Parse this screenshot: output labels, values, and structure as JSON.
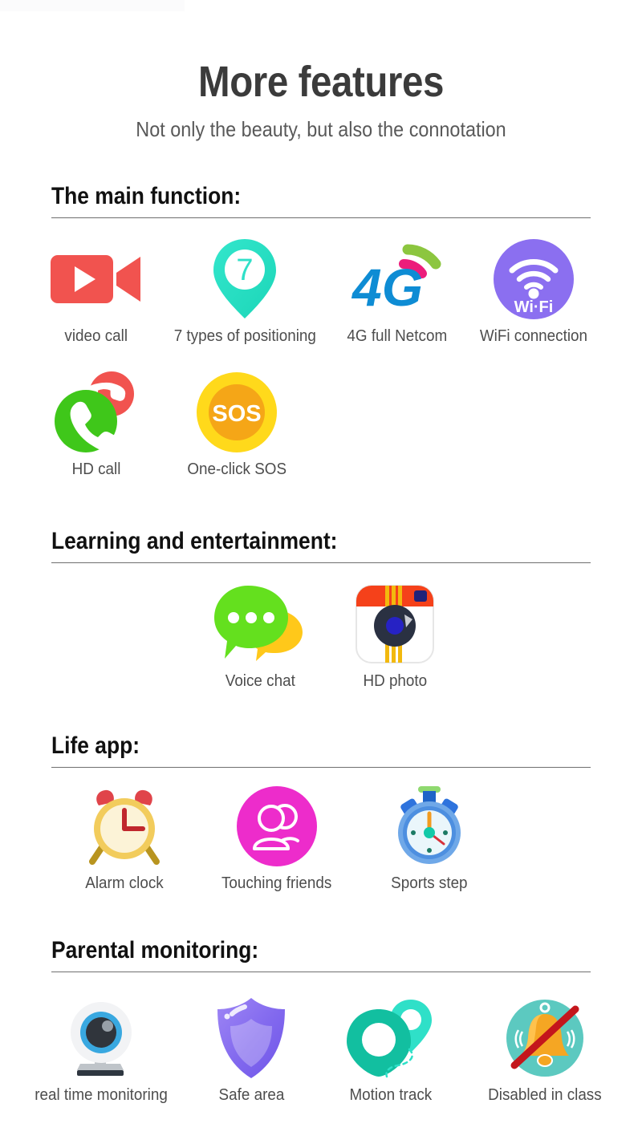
{
  "header": {
    "title": "More features",
    "subtitle": "Not only the beauty, but also the connotation"
  },
  "sections": [
    {
      "id": "main",
      "heading": "The main function:",
      "rows": [
        [
          {
            "icon": "video-camera-icon",
            "label": "video call"
          },
          {
            "icon": "location-pin-7-icon",
            "label": "7 types of positioning"
          },
          {
            "icon": "4g-signal-icon",
            "label": "4G full Netcom"
          },
          {
            "icon": "wifi-circle-icon",
            "label": "WiFi connection"
          }
        ],
        [
          {
            "icon": "phone-call-icon",
            "label": "HD call"
          },
          {
            "icon": "sos-button-icon",
            "label": "One-click SOS"
          }
        ]
      ]
    },
    {
      "id": "learn",
      "heading": "Learning and entertainment:",
      "rows": [
        [
          {
            "icon": "speech-bubbles-icon",
            "label": "Voice chat"
          },
          {
            "icon": "camera-app-icon",
            "label": "HD photo"
          }
        ]
      ]
    },
    {
      "id": "life",
      "heading": "Life app:",
      "rows": [
        [
          {
            "icon": "alarm-clock-icon",
            "label": "Alarm clock"
          },
          {
            "icon": "two-people-icon",
            "label": "Touching friends"
          },
          {
            "icon": "stopwatch-icon",
            "label": "Sports step"
          }
        ]
      ]
    },
    {
      "id": "parent",
      "heading": "Parental monitoring:",
      "rows": [
        [
          {
            "icon": "webcam-icon",
            "label": "real time monitoring"
          },
          {
            "icon": "shield-icon",
            "label": "Safe area"
          },
          {
            "icon": "motion-track-pins-icon",
            "label": "Motion track"
          },
          {
            "icon": "bell-disabled-icon",
            "label": "Disabled in class"
          }
        ]
      ]
    }
  ],
  "icon_text": {
    "pin_number": "7",
    "sos": "SOS",
    "four_g": "4G",
    "wifi": "Wi·Fi"
  },
  "colors": {
    "video_red": "#F1534F",
    "pin_teal": "#2FE0C8",
    "g4_blue": "#0E8CD4",
    "g4_pink": "#EC1D7B",
    "g4_green": "#8CC63F",
    "wifi_purple": "#8B6FF0",
    "call_green": "#3FC71A",
    "hangup_red": "#F1534F",
    "sos_yellow": "#FFD91B",
    "sos_orange": "#F5A617",
    "chat_green": "#64E01E",
    "chat_yellow": "#FFC81A",
    "camera_red": "#F5411A",
    "camera_yellow": "#F2B90E",
    "camera_navy": "#20227A",
    "clock_cream": "#FCF3D7",
    "clock_gold": "#F2CC5C",
    "clock_red": "#D73B3B",
    "friends_magenta": "#ED2CCB",
    "watch_blue": "#4D8FE0",
    "webcam_blue": "#39A8E0",
    "shield_purple": "#8C76F0",
    "track_teal": "#18CDAB",
    "bell_teal": "#5CC9C0",
    "bell_orange": "#F5A623",
    "strike_red": "#C4161C",
    "heading_black": "#111111",
    "label_gray": "#4d4d4d",
    "rule_gray": "#6f6f6f"
  }
}
